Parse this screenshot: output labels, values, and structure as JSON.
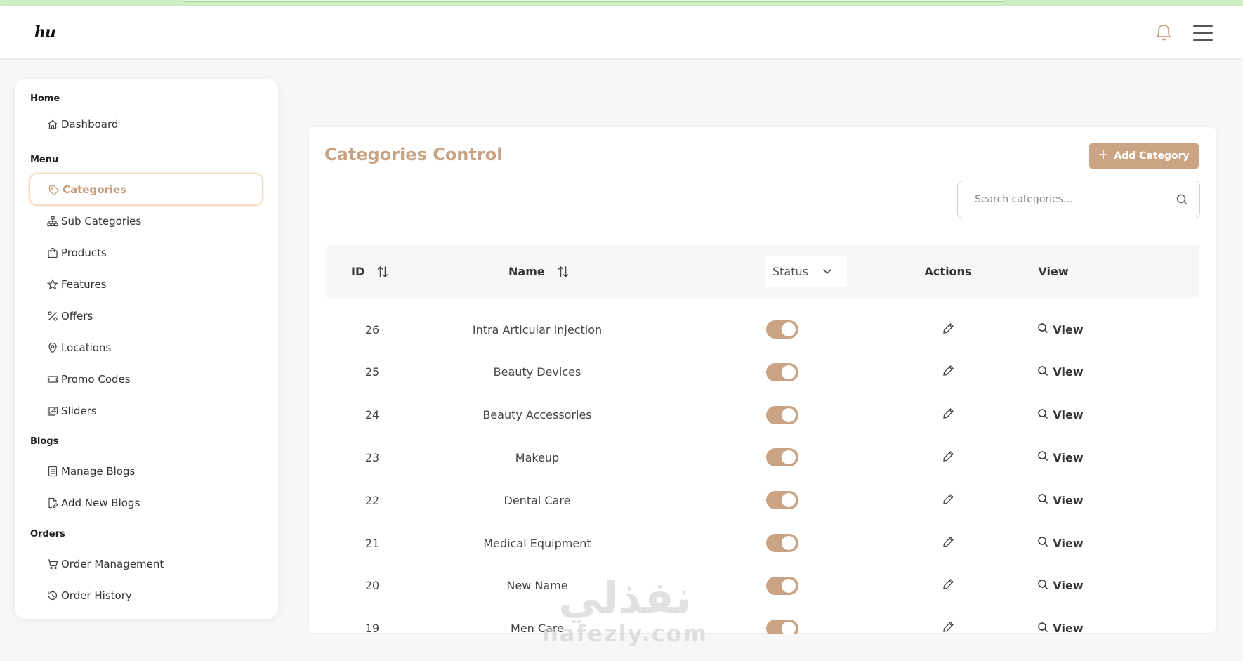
{
  "header": {
    "logo_text": "hu",
    "bell_icon": "bell-icon",
    "menu_icon": "hamburger-menu-icon"
  },
  "sidebar": {
    "sections": [
      {
        "title": "Home",
        "items": [
          {
            "label": "Dashboard",
            "icon": "home-icon"
          }
        ]
      },
      {
        "title": "Menu",
        "items": [
          {
            "label": "Categories",
            "icon": "tag-icon",
            "active": true
          },
          {
            "label": "Sub Categories",
            "icon": "sitemap-icon"
          },
          {
            "label": "Products",
            "icon": "shopping-bag-icon"
          },
          {
            "label": "Features",
            "icon": "star-icon"
          },
          {
            "label": "Offers",
            "icon": "percent-icon"
          },
          {
            "label": "Locations",
            "icon": "map-pin-icon"
          },
          {
            "label": "Promo Codes",
            "icon": "ticket-icon"
          },
          {
            "label": "Sliders",
            "icon": "images-icon"
          }
        ]
      },
      {
        "title": "Blogs",
        "items": [
          {
            "label": "Manage Blogs",
            "icon": "document-list-icon"
          },
          {
            "label": "Add New Blogs",
            "icon": "file-edit-icon"
          }
        ]
      },
      {
        "title": "Orders",
        "items": [
          {
            "label": "Order Management",
            "icon": "cart-icon"
          },
          {
            "label": "Order History",
            "icon": "history-icon"
          }
        ]
      }
    ]
  },
  "main": {
    "title": "Categories Control",
    "add_button_label": "Add Category",
    "search": {
      "placeholder": "Search categories...",
      "value": ""
    },
    "table": {
      "headers": {
        "id": "ID",
        "name": "Name",
        "status": "Status",
        "actions": "Actions",
        "view": "View"
      },
      "rows": [
        {
          "id": "26",
          "name": "Intra Articular Injection",
          "status": true,
          "view": "View"
        },
        {
          "id": "25",
          "name": "Beauty Devices",
          "status": true,
          "view": "View"
        },
        {
          "id": "24",
          "name": "Beauty Accessories",
          "status": true,
          "view": "View"
        },
        {
          "id": "23",
          "name": "Makeup",
          "status": true,
          "view": "View"
        },
        {
          "id": "22",
          "name": "Dental Care",
          "status": true,
          "view": "View"
        },
        {
          "id": "21",
          "name": "Medical Equipment",
          "status": true,
          "view": "View"
        },
        {
          "id": "20",
          "name": "New Name",
          "status": true,
          "view": "View"
        },
        {
          "id": "19",
          "name": "Men Care",
          "status": true,
          "view": "View"
        }
      ]
    }
  },
  "watermark": {
    "arabic": "نفذلي",
    "latin": "nafezly.com"
  },
  "colors": {
    "accent": "#cba483",
    "accent_text": "#c8a283",
    "active_border": "#f6dfc9"
  }
}
